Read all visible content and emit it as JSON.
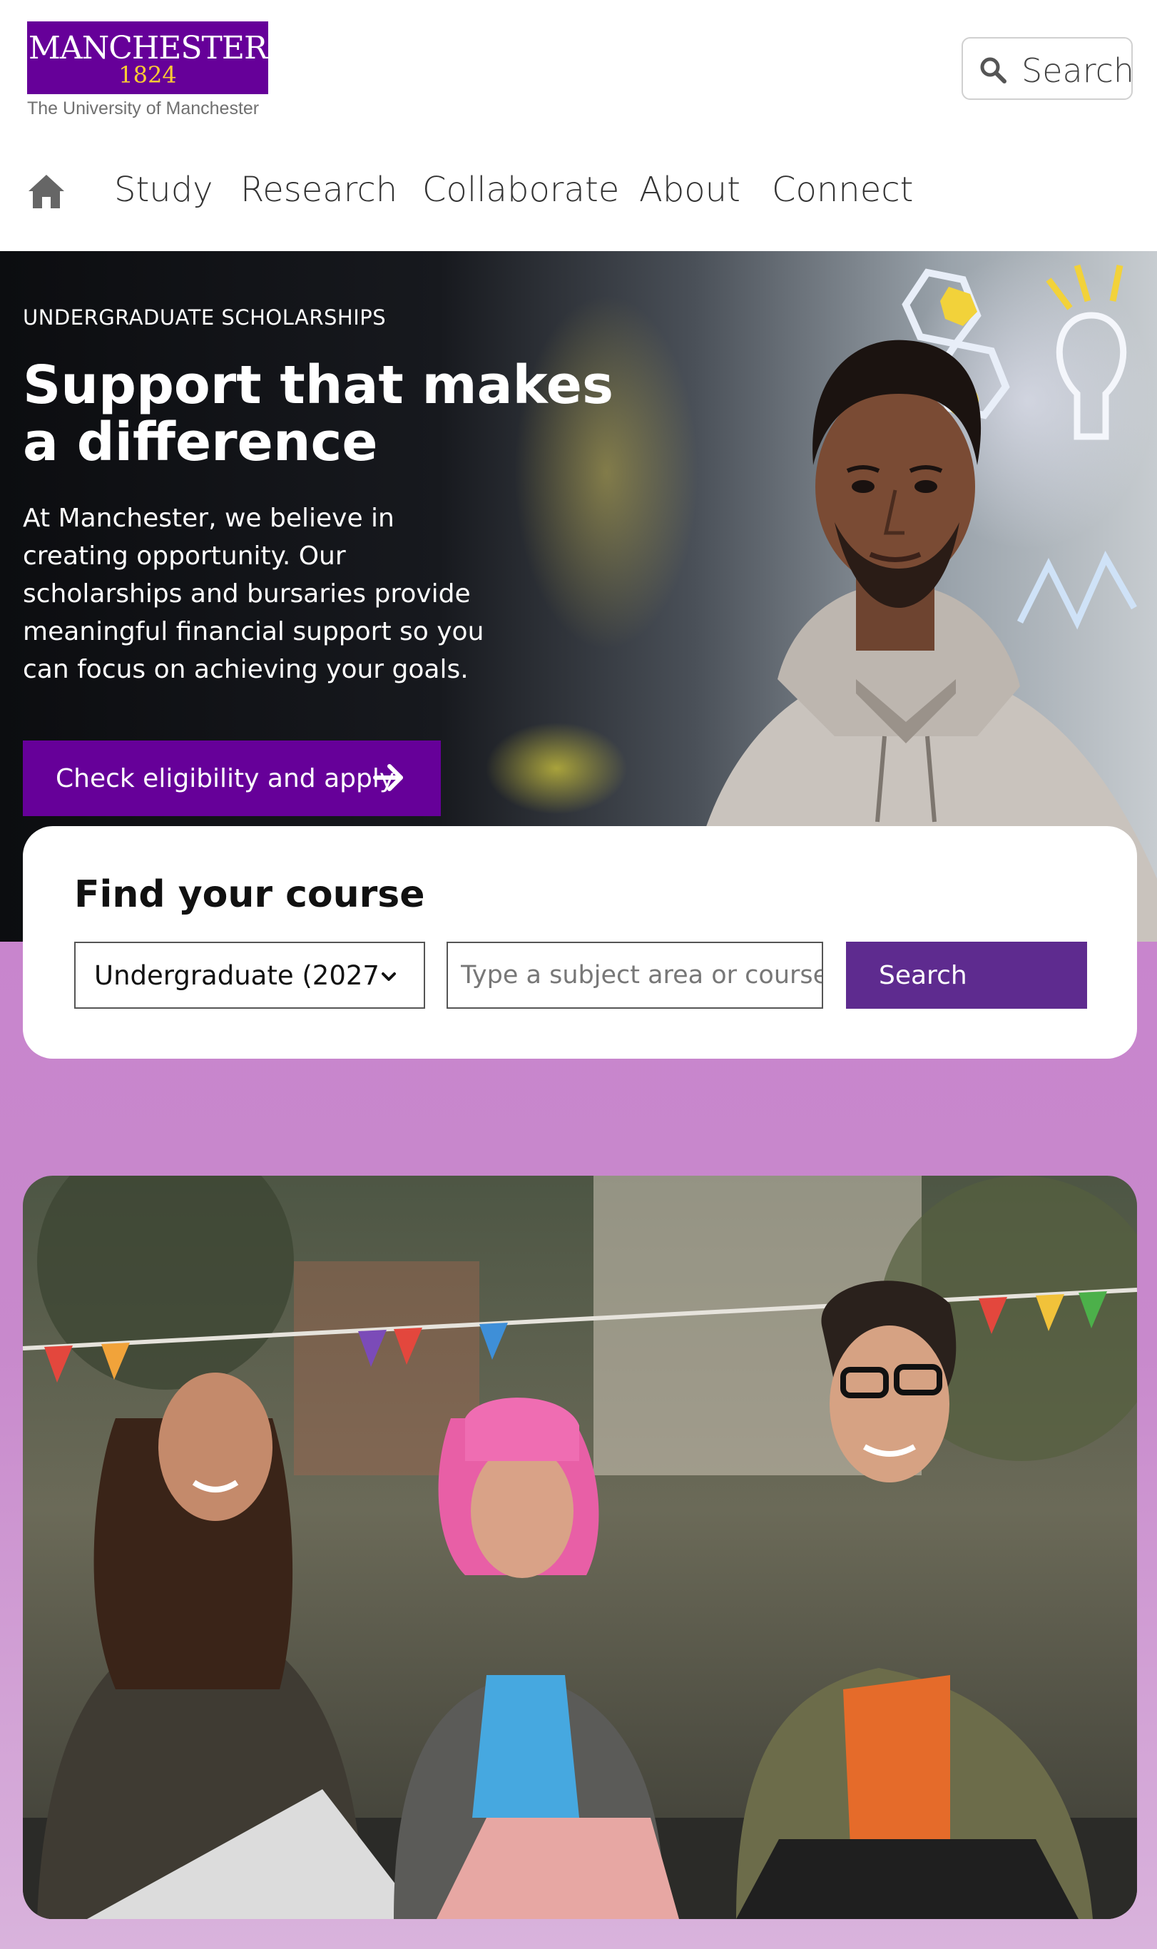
{
  "brand": {
    "wordmark": "MANCHESTER",
    "year": "1824",
    "subtitle": "The University of Manchester",
    "purple": "#660099",
    "gold": "#ffcc33"
  },
  "header": {
    "search_label": "Search",
    "search_icon": "search-icon"
  },
  "nav": {
    "home_icon": "home-icon",
    "items": [
      {
        "label": "Study"
      },
      {
        "label": "Research"
      },
      {
        "label": "Collaborate"
      },
      {
        "label": "About"
      },
      {
        "label": "Connect"
      }
    ]
  },
  "hero": {
    "eyebrow": "UNDERGRADUATE SCHOLARSHIPS",
    "title": "Support that makes a difference",
    "body": "At Manchester, we believe in creating opportunity. Our scholarships and bursaries provide meaningful financial support so you can focus on achieving your goals.",
    "cta_label": "Check eligibility and apply",
    "cta_icon": "arrow-right-icon"
  },
  "course_finder": {
    "title": "Find your course",
    "level_selected": "Undergraduate (2027",
    "level_icon": "chevron-down-icon",
    "input_placeholder": "Type a subject area or course",
    "input_value": "",
    "search_label": "Search"
  },
  "colors": {
    "band": "#c885cd",
    "button": "#5e2b8f"
  }
}
